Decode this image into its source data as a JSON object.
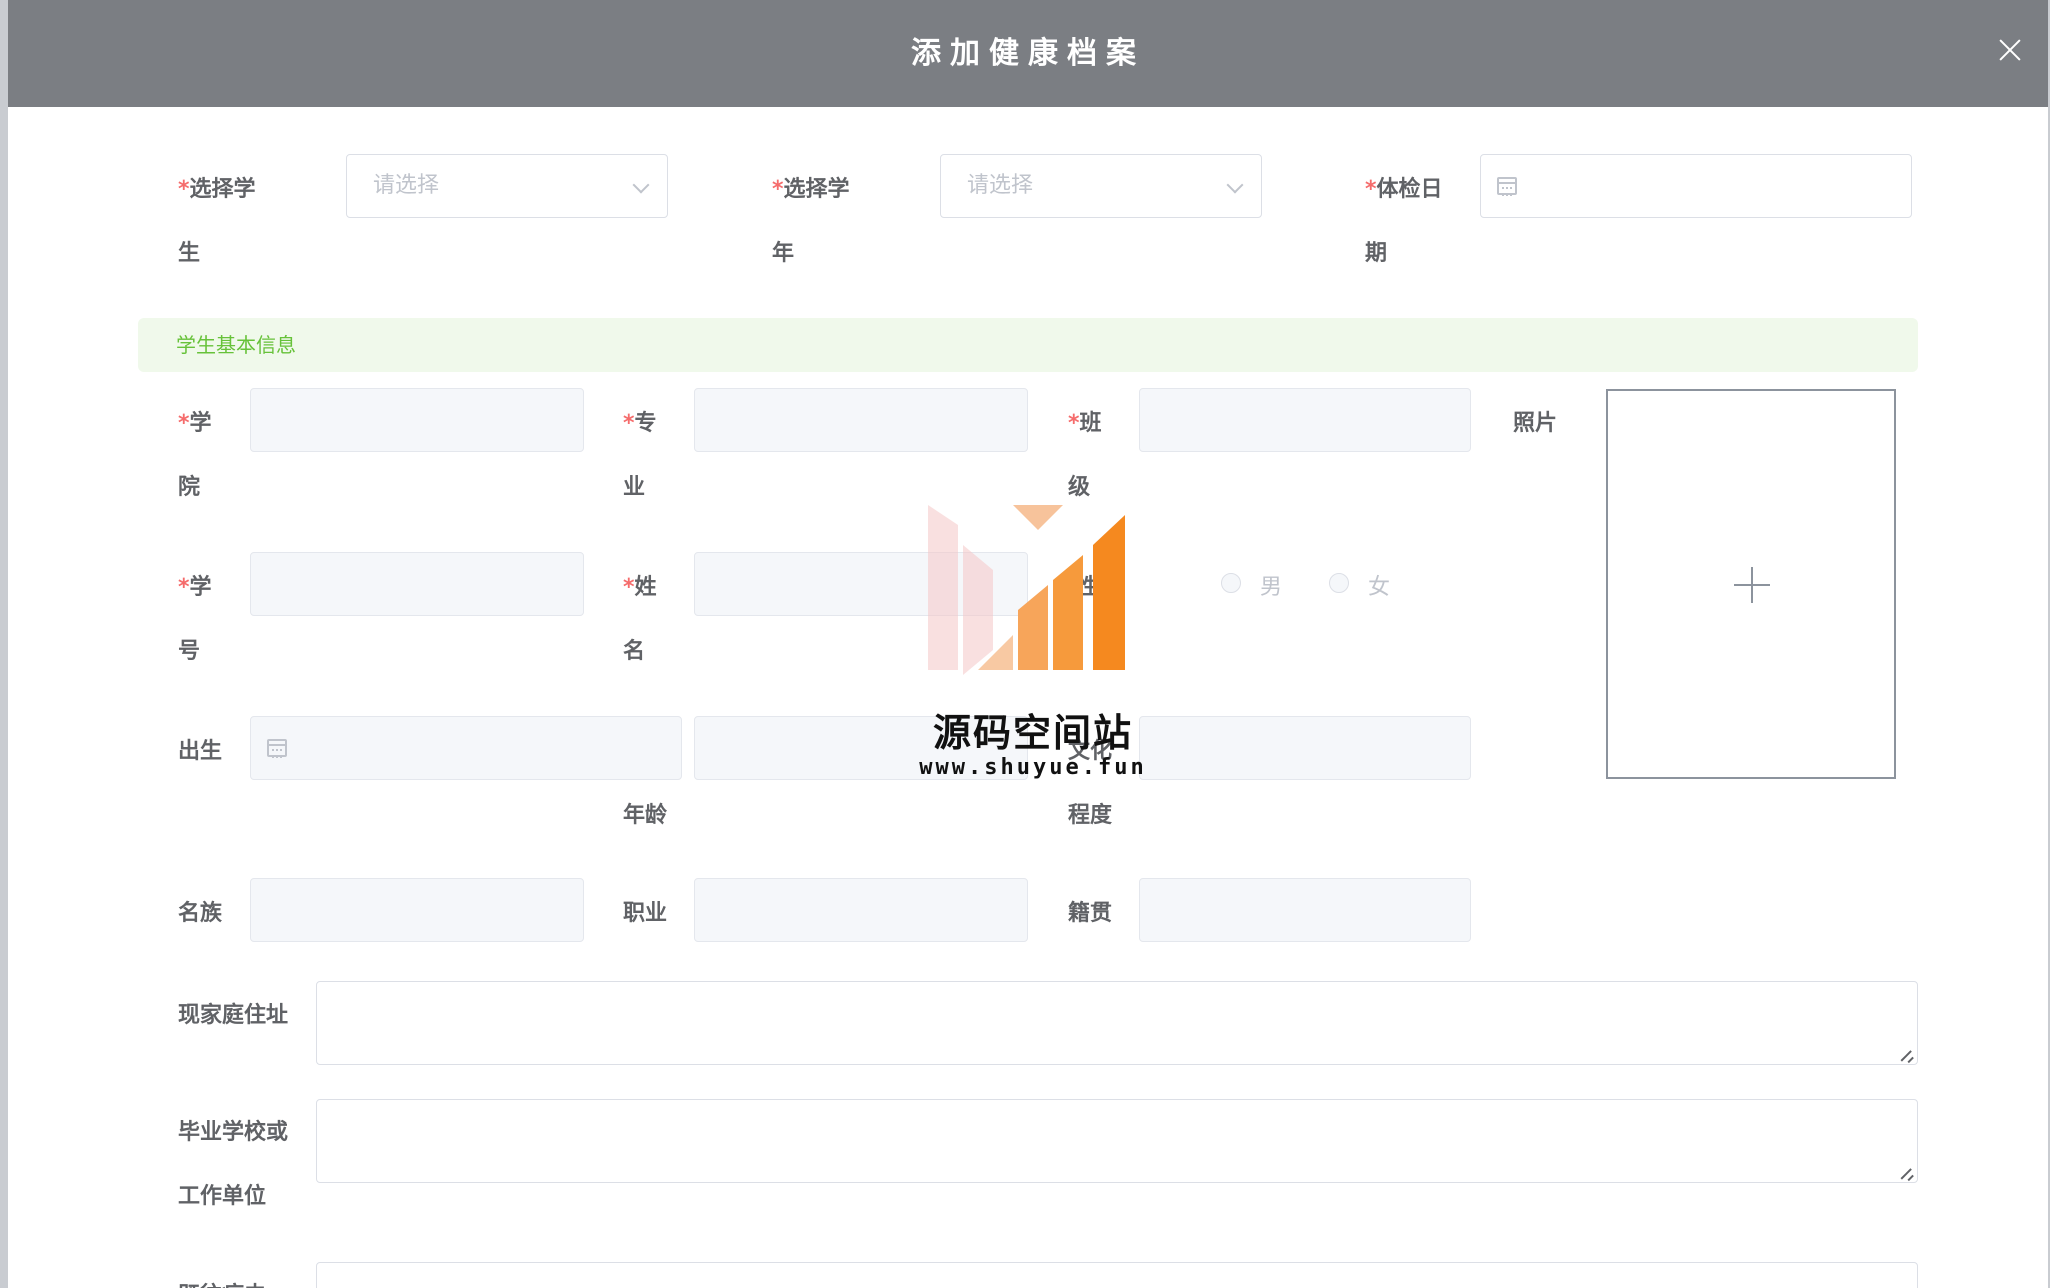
{
  "dialog": {
    "title": "添加健康档案"
  },
  "top_row": {
    "student": {
      "label_a": "选择学",
      "label_b": "生",
      "placeholder": "请选择"
    },
    "school_year": {
      "label_a": "选择学",
      "label_b": "年",
      "placeholder": "请选择"
    },
    "exam_date": {
      "label_a": "体检日",
      "label_b": "期"
    }
  },
  "section": {
    "title": "学生基本信息"
  },
  "fields": {
    "college": {
      "label_a": "学",
      "label_b": "院"
    },
    "major": {
      "label_a": "专",
      "label_b": "业"
    },
    "class": {
      "label_a": "班",
      "label_b": "级"
    },
    "photo": {
      "label": "照片"
    },
    "student_no": {
      "label_a": "学",
      "label_b": "号"
    },
    "name": {
      "label_a": "姓",
      "label_b": "名"
    },
    "gender": {
      "label": "性别",
      "options": [
        "男",
        "女"
      ]
    },
    "birth": {
      "label": "出生"
    },
    "age": {
      "label": "年龄"
    },
    "education": {
      "label_a": "文化",
      "label_b": "程度"
    },
    "ethnicity": {
      "label": "名族"
    },
    "occupation": {
      "label": "职业"
    },
    "native_place": {
      "label": "籍贯"
    },
    "address": {
      "label": "现家庭住址"
    },
    "school_work": {
      "label_a": "毕业学校或",
      "label_b": "工作单位"
    },
    "history": {
      "label": "既往病史"
    }
  },
  "watermark": {
    "name": "源码空间站",
    "url": "www.shuyue.fun"
  },
  "colors": {
    "header_bg": "#7b7e83",
    "required": "#f56c6c",
    "section_bg": "#f0f9eb",
    "section_text": "#67c23a",
    "watermark_orange": "#f5891f"
  }
}
